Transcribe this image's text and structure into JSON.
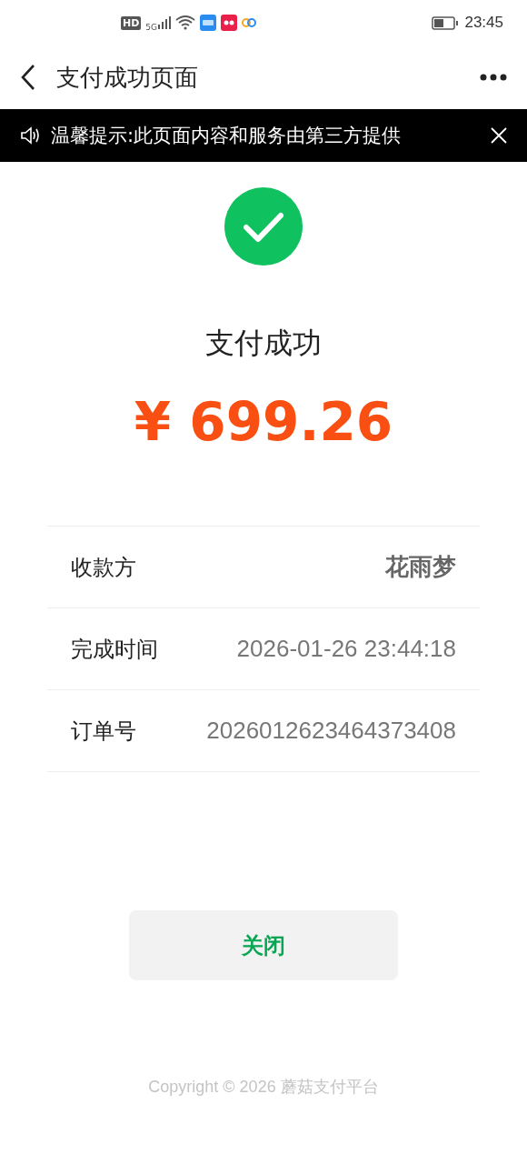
{
  "status_bar": {
    "hd": "HD",
    "network": "5G",
    "time": "23:45"
  },
  "nav": {
    "title": "支付成功页面"
  },
  "notice": {
    "text": "温馨提示:此页面内容和服务由第三方提供"
  },
  "result": {
    "title": "支付成功",
    "amount": "¥ 699.26"
  },
  "details": [
    {
      "label": "收款方",
      "value": "花雨梦",
      "emphasis": true
    },
    {
      "label": "完成时间",
      "value": "2026-01-26 23:44:18",
      "emphasis": false
    },
    {
      "label": "订单号",
      "value": "2026012623464373408",
      "emphasis": false
    }
  ],
  "close_button": "关闭",
  "footer": "Copyright © 2026 蘑菇支付平台"
}
